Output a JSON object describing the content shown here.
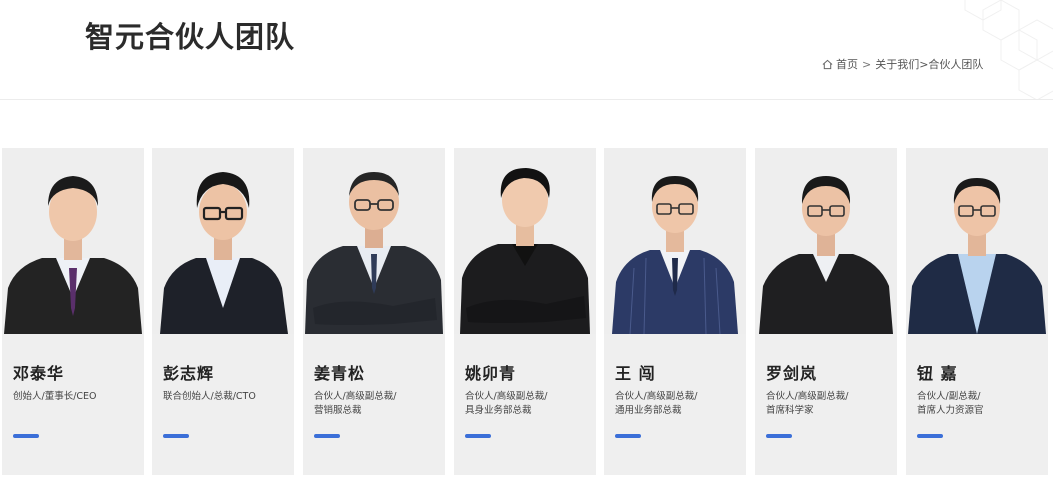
{
  "header": {
    "title": "智元合伙人团队",
    "breadcrumb": {
      "home": "首页",
      "separator": ">",
      "parent": "关于我们",
      "current": ">合伙人团队"
    }
  },
  "colors": {
    "accent": "#3b6fd8",
    "card_bg": "#efefef"
  },
  "team": [
    {
      "name": "邓泰华",
      "role_lines": [
        "创始人/董事长/CEO"
      ],
      "outfit": "suit-tie-purple"
    },
    {
      "name": "彭志辉",
      "role_lines": [
        "联合创始人/总裁/CTO"
      ],
      "outfit": "suit-open-collar-glasses"
    },
    {
      "name": "姜青松",
      "role_lines": [
        "合伙人/高级副总裁/",
        "营销服总裁"
      ],
      "outfit": "suit-tie-arms-crossed-glasses"
    },
    {
      "name": "姚卯青",
      "role_lines": [
        "合伙人/高级副总裁/",
        "具身业务部总裁"
      ],
      "outfit": "black-shirt-arms-crossed"
    },
    {
      "name": "王 闯",
      "role_lines": [
        "合伙人/高级副总裁/",
        "通用业务部总裁"
      ],
      "outfit": "pinstripe-suit-tie-glasses"
    },
    {
      "name": "罗剑岚",
      "role_lines": [
        "合伙人/高级副总裁/",
        "首席科学家"
      ],
      "outfit": "black-suit-glasses"
    },
    {
      "name": "钮 嘉",
      "role_lines": [
        "合伙人/副总裁/",
        "首席人力资源官"
      ],
      "outfit": "navy-suit-light-shirt-glasses"
    }
  ]
}
